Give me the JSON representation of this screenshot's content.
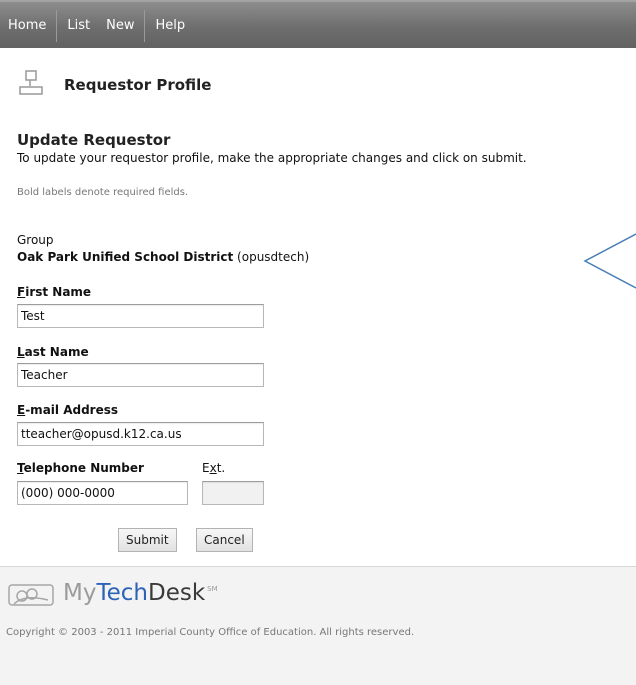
{
  "nav": {
    "items": [
      "Home",
      "List",
      "New",
      "Help"
    ]
  },
  "header": {
    "title": "Requestor Profile",
    "icon": "profile-icon"
  },
  "form": {
    "section_title": "Update Requestor",
    "instructions": "To update your requestor profile, make the appropriate changes and click on submit.",
    "required_note": "Bold labels denote required fields.",
    "group": {
      "label": "Group",
      "name": "Oak Park Unified School District",
      "code": "(opusdtech)"
    },
    "fields": {
      "first_name": {
        "label_first": "F",
        "label_rest": "irst Name",
        "value": "Test"
      },
      "last_name": {
        "label_first": "L",
        "label_rest": "ast Name",
        "value": "Teacher"
      },
      "email": {
        "label_first": "E",
        "label_rest": "-mail Address",
        "value": "tteacher@opusd.k12.ca.us"
      },
      "telephone": {
        "label_first": "T",
        "label_rest": "elephone Number",
        "value": "(000) 000-0000"
      },
      "ext": {
        "label_first": "E",
        "label_underline": "x",
        "label_rest": "t.",
        "value": ""
      }
    },
    "buttons": {
      "submit": "Submit",
      "cancel": "Cancel"
    }
  },
  "footer": {
    "brand_my": "My",
    "brand_tech": "Tech",
    "brand_desk": "Desk",
    "brand_mark": "SM",
    "copyright": "Copyright © 2003 - 2011 Imperial County Office of Education. All rights reserved."
  },
  "colors": {
    "nav_bg": "#6e6e6e",
    "brand_blue": "#2c63b8",
    "callout": "#4a7fb5"
  }
}
